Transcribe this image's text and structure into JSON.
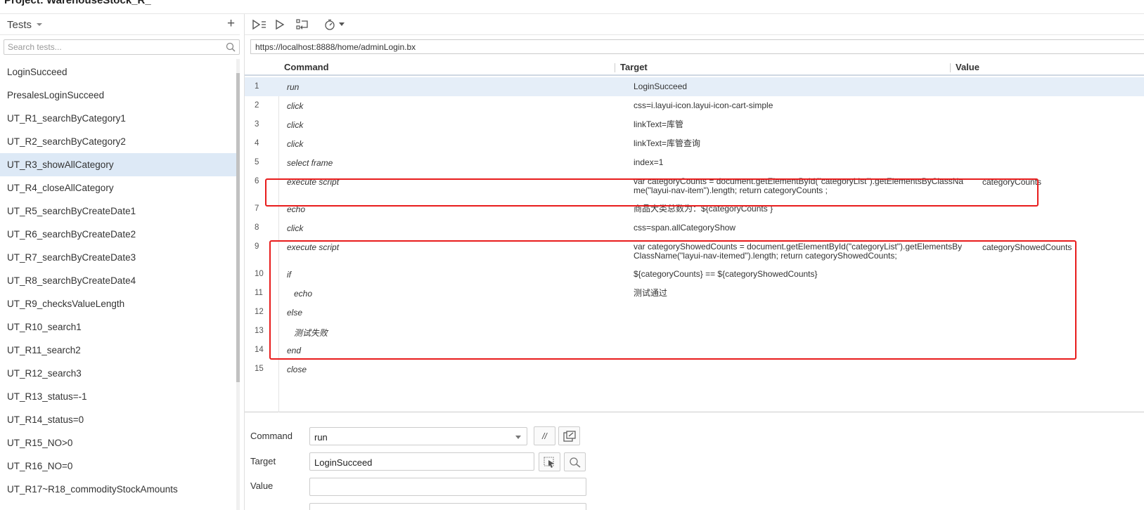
{
  "project": {
    "title": "Project: WarehouseStock_R_"
  },
  "sidebar": {
    "header_label": "Tests",
    "add_icon": "plus-icon",
    "search_placeholder": "Search tests...",
    "tests": [
      {
        "label": "LoginSucceed"
      },
      {
        "label": "PresalesLoginSucceed"
      },
      {
        "label": "UT_R1_searchByCategory1"
      },
      {
        "label": "UT_R2_searchByCategory2"
      },
      {
        "label": "UT_R3_showAllCategory",
        "selected": true
      },
      {
        "label": "UT_R4_closeAllCategory"
      },
      {
        "label": "UT_R5_searchByCreateDate1"
      },
      {
        "label": "UT_R6_searchByCreateDate2"
      },
      {
        "label": "UT_R7_searchByCreateDate3"
      },
      {
        "label": "UT_R8_searchByCreateDate4"
      },
      {
        "label": "UT_R9_checksValueLength"
      },
      {
        "label": "UT_R10_search1"
      },
      {
        "label": "UT_R11_search2"
      },
      {
        "label": "UT_R12_search3"
      },
      {
        "label": "UT_R13_status=-1"
      },
      {
        "label": "UT_R14_status=0"
      },
      {
        "label": "UT_R15_NO>0"
      },
      {
        "label": "UT_R16_NO=0"
      },
      {
        "label": "UT_R17~R18_commodityStockAmounts"
      }
    ]
  },
  "toolbar": {
    "icons": [
      "run-all-tests-icon",
      "run-current-test-icon",
      "step-over-icon",
      "speed-timer-icon"
    ]
  },
  "url": "https://localhost:8888/home/adminLogin.bx",
  "grid": {
    "headers": {
      "command": "Command",
      "target": "Target",
      "value": "Value"
    },
    "rows": [
      {
        "num": "1",
        "command": "run",
        "target": "LoginSucceed",
        "value": ""
      },
      {
        "num": "2",
        "command": "click",
        "target": "css=i.layui-icon.layui-icon-cart-simple",
        "value": ""
      },
      {
        "num": "3",
        "command": "click",
        "target": "linkText=库管",
        "value": ""
      },
      {
        "num": "4",
        "command": "click",
        "target": "linkText=库管查询",
        "value": ""
      },
      {
        "num": "5",
        "command": "select frame",
        "target": "index=1",
        "value": ""
      },
      {
        "num": "6",
        "command": "execute script",
        "target": "var categoryCounts = document.getElementById(\"categoryList\").getElementsByClassName(\"layui-nav-item\").length; return categoryCounts ;",
        "value": "categoryCounts"
      },
      {
        "num": "7",
        "command": "echo",
        "target": "商品大类总数为：${categoryCounts }",
        "value": ""
      },
      {
        "num": "8",
        "command": "click",
        "target": "css=span.allCategoryShow",
        "value": ""
      },
      {
        "num": "9",
        "command": "execute script",
        "target": "var categoryShowedCounts = document.getElementById(\"categoryList\").getElementsByClassName(\"layui-nav-itemed\").length; return categoryShowedCounts;",
        "value": "categoryShowedCounts"
      },
      {
        "num": "10",
        "command": "if",
        "target": "${categoryCounts} == ${categoryShowedCounts}",
        "value": ""
      },
      {
        "num": "11",
        "command": "echo",
        "target": "测试通过",
        "value": ""
      },
      {
        "num": "12",
        "command": "else",
        "target": "",
        "value": ""
      },
      {
        "num": "13",
        "command": "测试失败",
        "target": "",
        "value": ""
      },
      {
        "num": "14",
        "command": "end",
        "target": "",
        "value": ""
      },
      {
        "num": "15",
        "command": "close",
        "target": "",
        "value": ""
      }
    ]
  },
  "editor": {
    "command_label": "Command",
    "command_value": "run",
    "comment_button": "//",
    "target_label": "Target",
    "target_value": "LoginSucceed",
    "value_label": "Value",
    "value_value": ""
  },
  "colors": {
    "selection": "#dde9f6",
    "highlight_box": "#e81c1c"
  }
}
